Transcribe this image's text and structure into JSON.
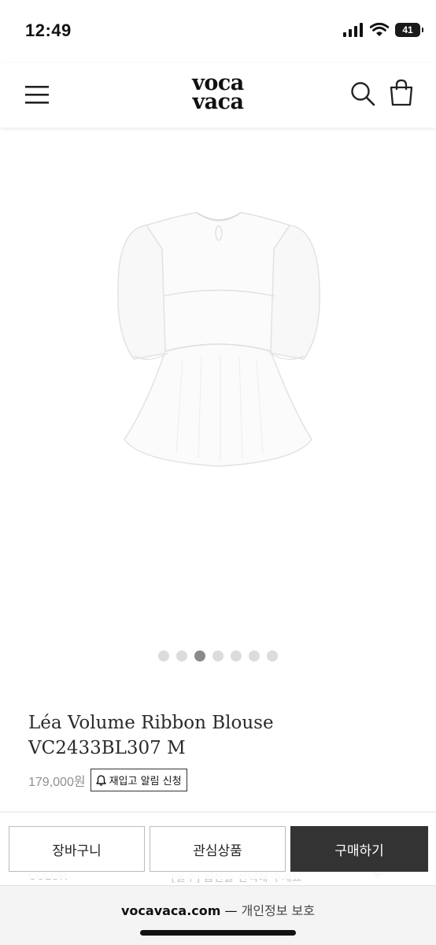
{
  "status_bar": {
    "time": "12:49",
    "battery": "41",
    "icons": [
      "signal-icon",
      "wifi-icon",
      "battery-icon"
    ]
  },
  "header": {
    "logo_line1": "voca",
    "logo_line2": "vaca",
    "icons": [
      "menu-icon",
      "search-icon",
      "shopping-bag-icon"
    ]
  },
  "gallery": {
    "image_count": 7,
    "active_index": 2
  },
  "product": {
    "title": "Léa Volume Ribbon Blouse VC2433BL307 M",
    "price": "179,000원",
    "restock_label": "재입고 알림 신청"
  },
  "options": {
    "label": "COLOR",
    "select_placeholder": "- [필수] 옵션을 선택해 주세요 -"
  },
  "actions": {
    "cart": "장바구니",
    "wishlist": "관심상품",
    "buy": "구매하기"
  },
  "footer": {
    "domain": "vocavaca.com",
    "separator": " — ",
    "policy": "개인정보 보호"
  },
  "colors": {
    "buy_button": "#333333",
    "price": "#8f8f8f",
    "dot_active": "#8a8a8a",
    "dot_inactive": "#dcdcdc"
  }
}
